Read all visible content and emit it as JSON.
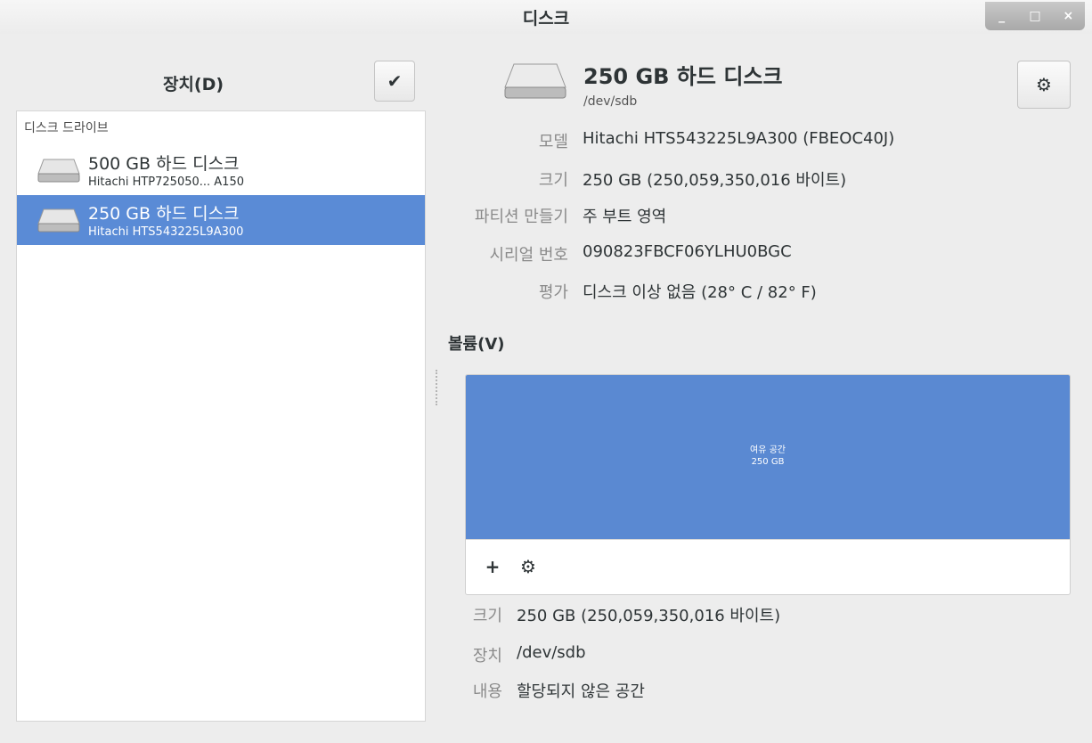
{
  "window": {
    "title": "디스크",
    "controls": {
      "minimize": "_",
      "maximize": "□",
      "close": "×"
    }
  },
  "sidebar": {
    "title": "장치(D)",
    "section_label": "디스크 드라이브",
    "drives": [
      {
        "name": "500 GB 하드 디스크",
        "model": "Hitachi HTP725050... A150",
        "selected": false
      },
      {
        "name": "250 GB 하드 디스크",
        "model": "Hitachi HTS543225L9A300",
        "selected": true
      }
    ]
  },
  "disk": {
    "title": "250 GB 하드 디스크",
    "path": "/dev/sdb",
    "properties": [
      {
        "label": "모델",
        "value": "Hitachi HTS543225L9A300 (FBEOC40J)"
      },
      {
        "label": "크기",
        "value": "250 GB (250,059,350,016 바이트)"
      },
      {
        "label": "파티션 만들기",
        "value": "주 부트 영역"
      },
      {
        "label": "시리얼 번호",
        "value": "090823FBCF06YLHU0BGC"
      },
      {
        "label": "평가",
        "value": "디스크 이상 없음 (28° C / 82° F)"
      }
    ]
  },
  "volumes": {
    "title": "볼륨(V)",
    "bar_label_line1": "여유 공간",
    "bar_label_line2": "250 GB",
    "bar_color": "#5a89d2",
    "toolbar": {
      "add": "+",
      "settings": "⚙"
    },
    "details": [
      {
        "label": "크기",
        "value": "250 GB (250,059,350,016 바이트)"
      },
      {
        "label": "장치",
        "value": "/dev/sdb"
      },
      {
        "label": "내용",
        "value": "할당되지 않은 공간"
      }
    ]
  },
  "colors": {
    "selection": "#5a8bd6",
    "accent": "#5a89d2"
  }
}
